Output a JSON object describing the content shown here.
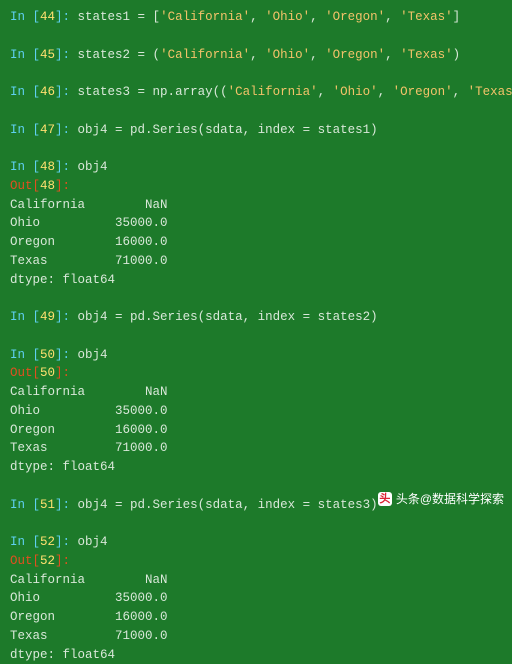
{
  "cells": [
    {
      "in_n": "44",
      "code_parts": [
        [
          "kw",
          "states1 = ["
        ],
        [
          "str",
          "'California'"
        ],
        [
          "kw",
          ", "
        ],
        [
          "str",
          "'Ohio'"
        ],
        [
          "kw",
          ", "
        ],
        [
          "str",
          "'Oregon'"
        ],
        [
          "kw",
          ", "
        ],
        [
          "str",
          "'Texas'"
        ],
        [
          "kw",
          "]"
        ]
      ]
    },
    {
      "spacer": true
    },
    {
      "in_n": "45",
      "code_parts": [
        [
          "kw",
          "states2 = ("
        ],
        [
          "str",
          "'California'"
        ],
        [
          "kw",
          ", "
        ],
        [
          "str",
          "'Ohio'"
        ],
        [
          "kw",
          ", "
        ],
        [
          "str",
          "'Oregon'"
        ],
        [
          "kw",
          ", "
        ],
        [
          "str",
          "'Texas'"
        ],
        [
          "kw",
          ")"
        ]
      ]
    },
    {
      "spacer": true
    },
    {
      "in_n": "46",
      "code_parts": [
        [
          "kw",
          "states3 = np.array(("
        ],
        [
          "str",
          "'California'"
        ],
        [
          "kw",
          ", "
        ],
        [
          "str",
          "'Ohio'"
        ],
        [
          "kw",
          ", "
        ],
        [
          "str",
          "'Oregon'"
        ],
        [
          "kw",
          ", "
        ],
        [
          "str",
          "'Texas'"
        ],
        [
          "kw",
          "))"
        ]
      ]
    },
    {
      "spacer": true
    },
    {
      "in_n": "47",
      "code_parts": [
        [
          "kw",
          "obj4 = pd.Series(sdata, index = states1)"
        ]
      ]
    },
    {
      "spacer": true
    },
    {
      "in_n": "48",
      "code_parts": [
        [
          "kw",
          "obj4"
        ]
      ]
    },
    {
      "out_n": "48"
    },
    {
      "plain": "California        NaN"
    },
    {
      "plain": "Ohio          35000.0"
    },
    {
      "plain": "Oregon        16000.0"
    },
    {
      "plain": "Texas         71000.0"
    },
    {
      "plain": "dtype: float64"
    },
    {
      "spacer": true
    },
    {
      "in_n": "49",
      "code_parts": [
        [
          "kw",
          "obj4 = pd.Series(sdata, index = states2)"
        ]
      ]
    },
    {
      "spacer": true
    },
    {
      "in_n": "50",
      "code_parts": [
        [
          "kw",
          "obj4"
        ]
      ]
    },
    {
      "out_n": "50"
    },
    {
      "plain": "California        NaN"
    },
    {
      "plain": "Ohio          35000.0"
    },
    {
      "plain": "Oregon        16000.0"
    },
    {
      "plain": "Texas         71000.0"
    },
    {
      "plain": "dtype: float64"
    },
    {
      "spacer": true
    },
    {
      "in_n": "51",
      "code_parts": [
        [
          "kw",
          "obj4 = pd.Series(sdata, index = states3)"
        ]
      ]
    },
    {
      "spacer": true
    },
    {
      "in_n": "52",
      "code_parts": [
        [
          "kw",
          "obj4"
        ]
      ]
    },
    {
      "out_n": "52"
    },
    {
      "plain": "California        NaN"
    },
    {
      "plain": "Ohio          35000.0"
    },
    {
      "plain": "Oregon        16000.0"
    },
    {
      "plain": "Texas         71000.0"
    },
    {
      "plain": "dtype: float64"
    }
  ],
  "prompt": {
    "in_prefix": "In [",
    "in_suffix": "]:",
    "out_prefix": "Out[",
    "out_suffix": "]:"
  },
  "attribution": {
    "logo_text": "头",
    "label": "头条@数据科学探索"
  }
}
